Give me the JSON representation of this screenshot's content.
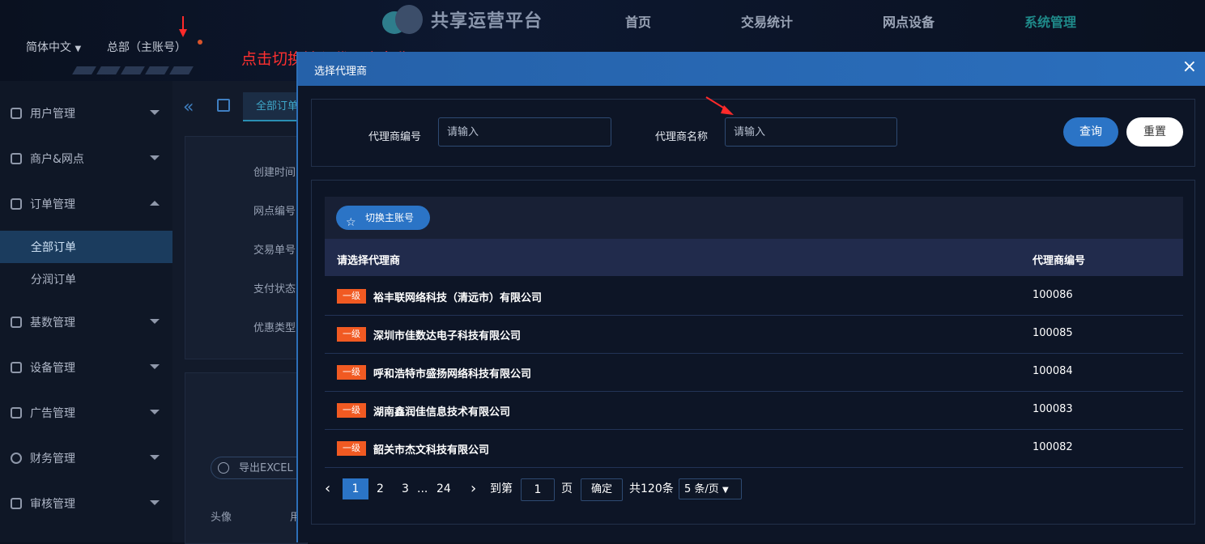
{
  "header": {
    "logo_text": "共享运营平台",
    "nav": [
      "首页",
      "交易统计",
      "网点设备",
      "系统管理"
    ],
    "active_nav": "系统管理",
    "language": "简体中文",
    "account": "总部（主账号）"
  },
  "annotation": {
    "text": "点击切换输入代理商名称",
    "color": "#ff3030"
  },
  "sidebar": {
    "items": [
      {
        "label": "用户管理",
        "icon": "user-icon"
      },
      {
        "label": "商户&网点",
        "icon": "cube-icon"
      },
      {
        "label": "订单管理",
        "icon": "clipboard-icon"
      },
      {
        "label": "基数管理",
        "icon": "thumb-icon"
      },
      {
        "label": "设备管理",
        "icon": "device-icon"
      },
      {
        "label": "广告管理",
        "icon": "image-icon"
      },
      {
        "label": "财务管理",
        "icon": "dollar-icon"
      },
      {
        "label": "审核管理",
        "icon": "edit-icon"
      }
    ],
    "sub_items": [
      "全部订单",
      "分润订单"
    ],
    "active_sub": "全部订单"
  },
  "background_page": {
    "tab_label": "全部订单",
    "filter_labels": [
      "创建时间",
      "网点编号",
      "交易单号",
      "支付状态",
      "优惠类型"
    ],
    "export_label": "导出EXCEL",
    "table_headers": [
      "头像",
      "用"
    ]
  },
  "modal": {
    "title": "选择代理商",
    "close_glyph": "×",
    "search": {
      "code_label": "代理商编号",
      "code_placeholder": "请输入",
      "name_label": "代理商名称",
      "name_placeholder": "请输入",
      "query_label": "查询",
      "reset_label": "重置"
    },
    "switch_button": "切换主账号",
    "table": {
      "headers": [
        "请选择代理商",
        "代理商编号"
      ],
      "rows": [
        {
          "tag": "一级",
          "name": "裕丰联网络科技（清远市）有限公司",
          "code": "100086"
        },
        {
          "tag": "一级",
          "name": "深圳市佳数达电子科技有限公司",
          "code": "100085"
        },
        {
          "tag": "一级",
          "name": "呼和浩特市盛扬网络科技有限公司",
          "code": "100084"
        },
        {
          "tag": "一级",
          "name": "湖南鑫润佳信息技术有限公司",
          "code": "100083"
        },
        {
          "tag": "一级",
          "name": "韶关市杰文科技有限公司",
          "code": "100082"
        }
      ]
    },
    "pagination": {
      "pages": [
        "1",
        "2",
        "3",
        "...",
        "24"
      ],
      "current": "1",
      "goto_label": "到第",
      "goto_value": "1",
      "page_unit": "页",
      "confirm_label": "确定",
      "total_label": "共120条",
      "page_size": "5 条/页"
    }
  },
  "colors": {
    "accent": "#2b74c6",
    "tag": "#f15a22",
    "modal_header": "#2561a9"
  }
}
